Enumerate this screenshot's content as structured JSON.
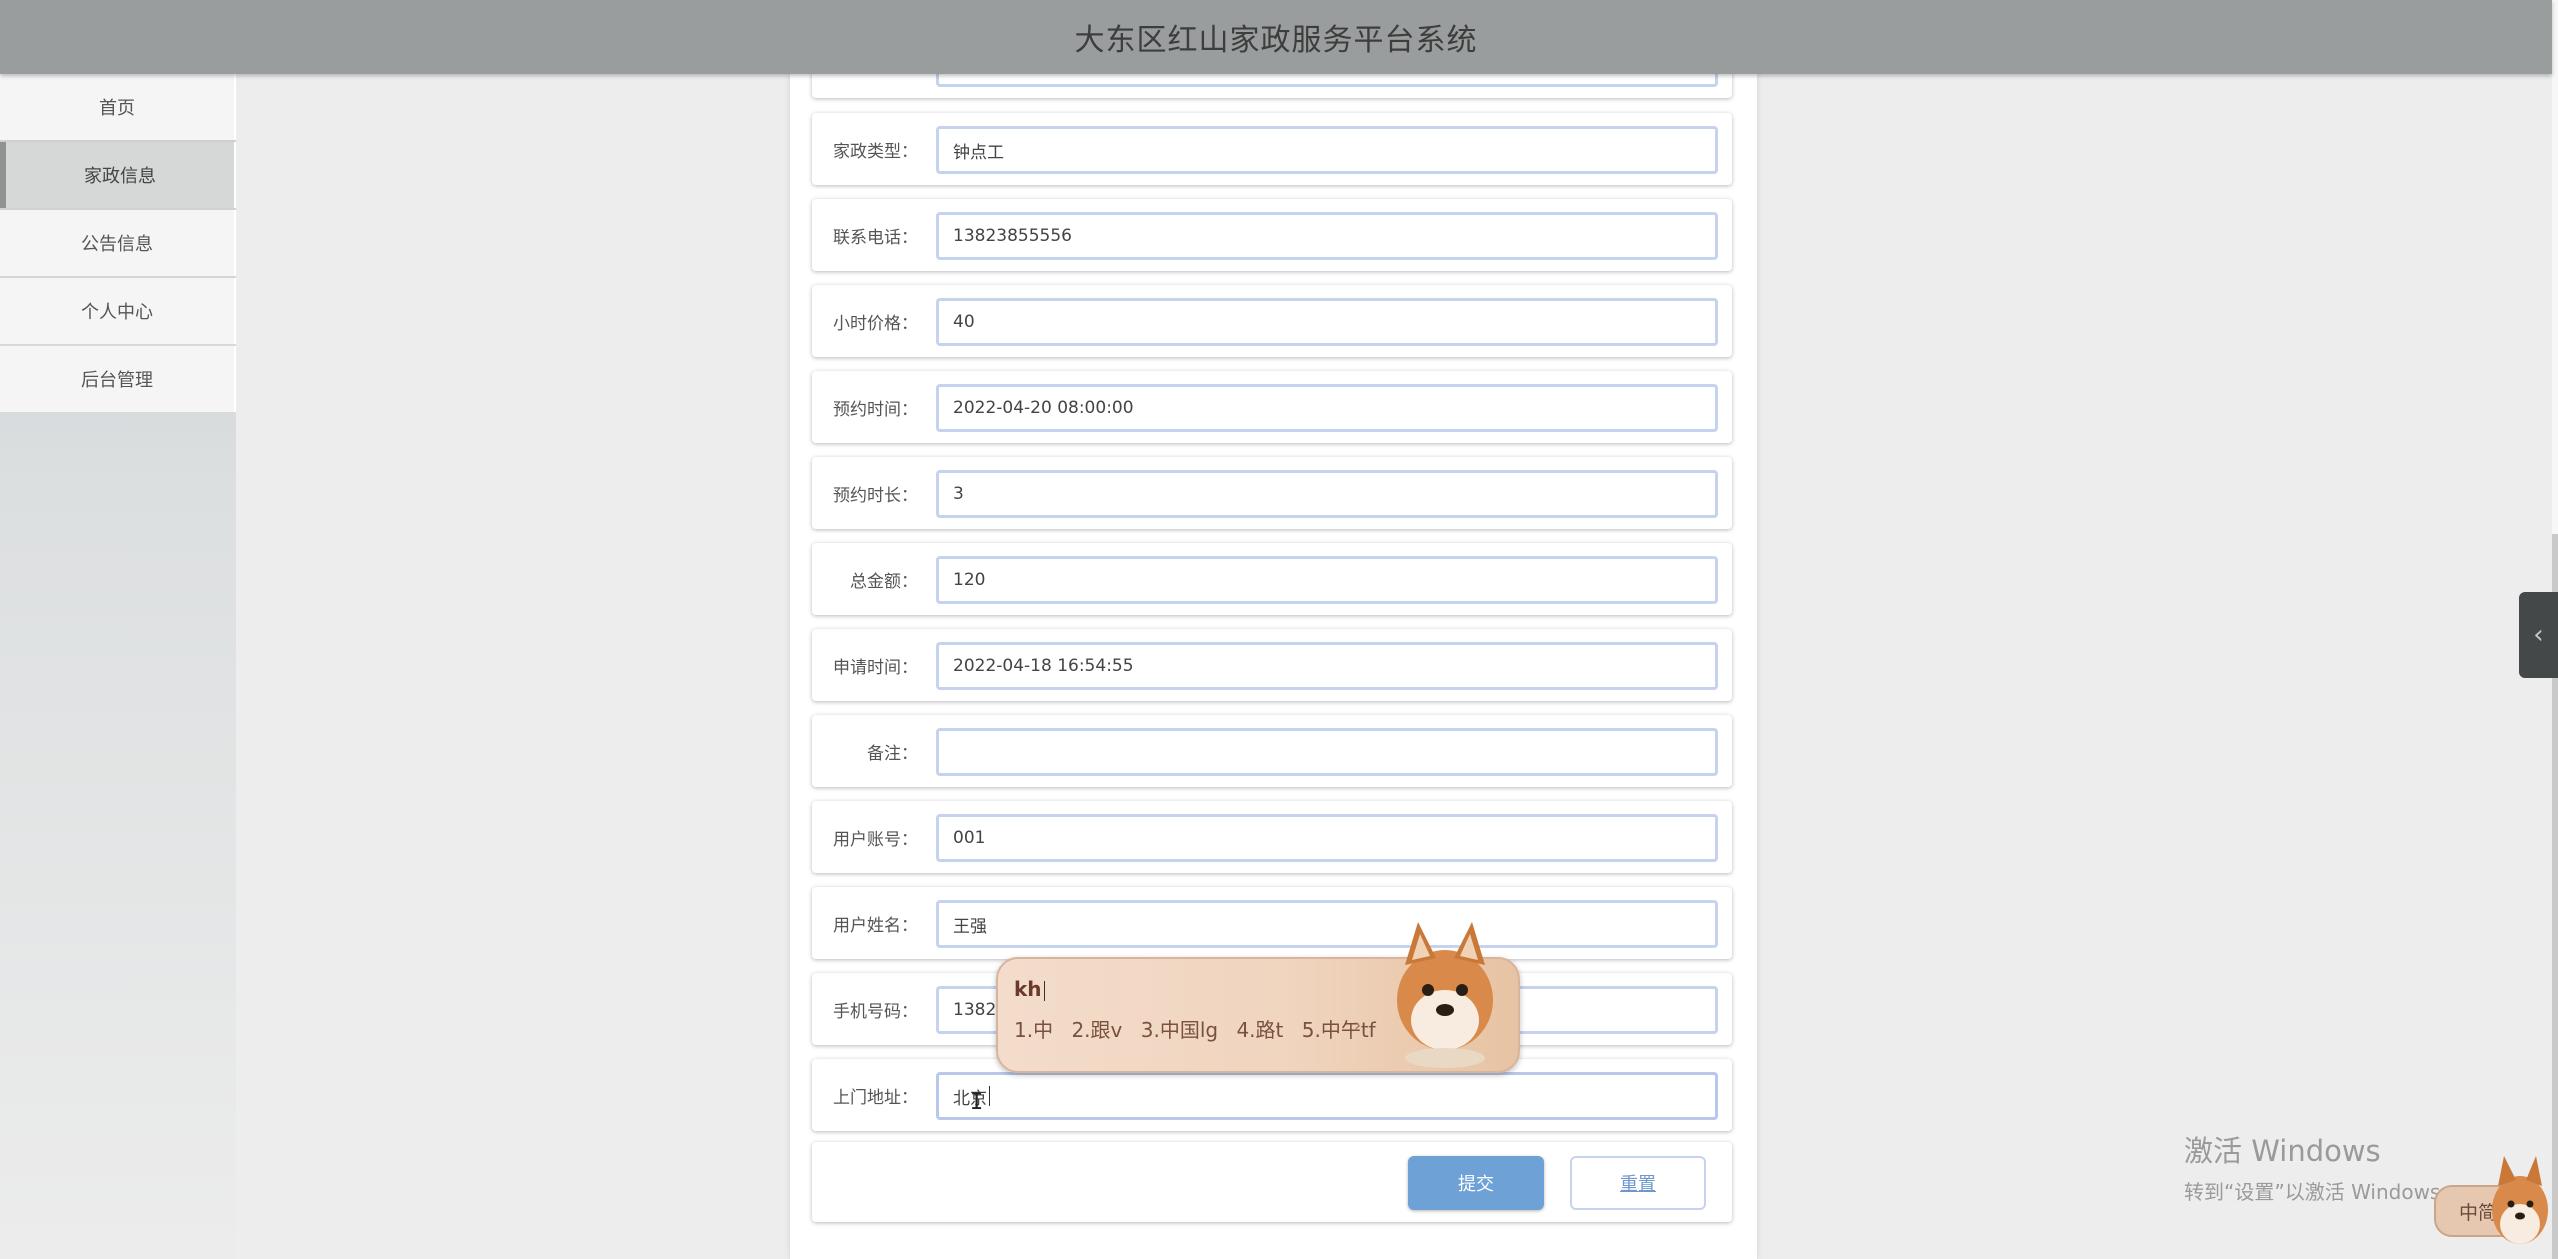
{
  "app": {
    "title": "大东区红山家政服务平台系统"
  },
  "sidebar": {
    "items": [
      {
        "label": "首页",
        "active": false
      },
      {
        "label": "家政信息",
        "active": true
      },
      {
        "label": "公告信息",
        "active": false
      },
      {
        "label": "个人中心",
        "active": false
      },
      {
        "label": "后台管理",
        "active": false
      }
    ]
  },
  "form": {
    "fields": [
      {
        "label": "",
        "value": ""
      },
      {
        "label": "家政类型：",
        "value": "钟点工"
      },
      {
        "label": "联系电话：",
        "value": "13823855556"
      },
      {
        "label": "小时价格：",
        "value": "40"
      },
      {
        "label": "预约时间：",
        "value": "2022-04-20 08:00:00"
      },
      {
        "label": "预约时长：",
        "value": "3"
      },
      {
        "label": "总金额：",
        "value": "120"
      },
      {
        "label": "申请时间：",
        "value": "2022-04-18 16:54:55"
      },
      {
        "label": "备注：",
        "value": ""
      },
      {
        "label": "用户账号：",
        "value": "001"
      },
      {
        "label": "用户姓名：",
        "value": "王强"
      },
      {
        "label": "手机号码：",
        "value": "1382"
      },
      {
        "label": "上门地址：",
        "value": "北京"
      }
    ],
    "submit_label": "提交",
    "reset_label": "重置"
  },
  "ime": {
    "composition": "kh",
    "candidates": [
      "1.中",
      "2.跟v",
      "3.中国lg",
      "4.路t",
      "5.中午tf"
    ],
    "next_arrow": "›",
    "mode_label": "中简"
  },
  "watermark": {
    "line1": "激活 Windows",
    "line2": "转到“设置”以激活 Windows。"
  },
  "side_tab": {
    "icon": "chevron-left-icon",
    "glyph": "‹"
  },
  "colors": {
    "topbar": "#9a9d9d",
    "submit": "#6ea1d6",
    "field_border": "#c6d3ee"
  }
}
